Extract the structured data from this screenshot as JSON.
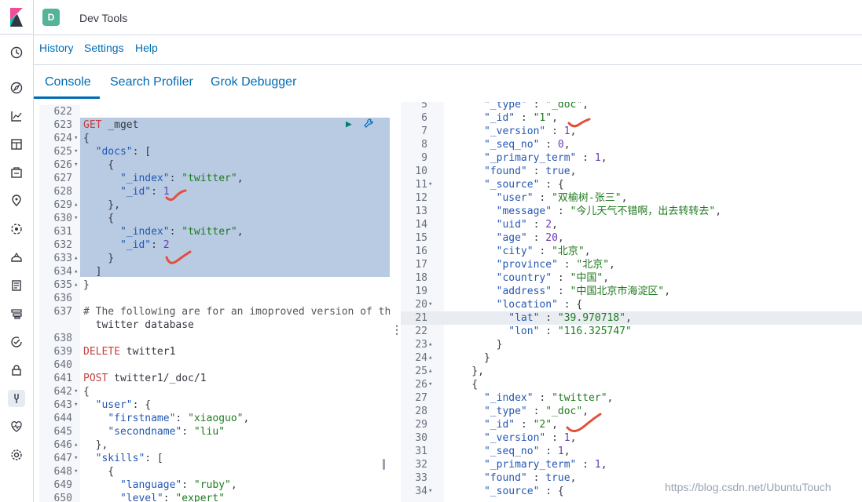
{
  "header": {
    "avatar_letter": "D",
    "title": "Dev Tools"
  },
  "top_menu": {
    "history": "History",
    "settings": "Settings",
    "help": "Help"
  },
  "tabs": {
    "console": "Console",
    "search_profiler": "Search Profiler",
    "grok_debugger": "Grok Debugger"
  },
  "editor": {
    "lines": [
      {
        "n": "622",
        "f": "",
        "t": ""
      },
      {
        "n": "623",
        "f": "",
        "t": "GET _mget"
      },
      {
        "n": "624",
        "f": "▾",
        "t": "{"
      },
      {
        "n": "625",
        "f": "▾",
        "t": "  \"docs\": ["
      },
      {
        "n": "626",
        "f": "▾",
        "t": "    {"
      },
      {
        "n": "627",
        "f": "",
        "t": "      \"_index\": \"twitter\","
      },
      {
        "n": "628",
        "f": "",
        "t": "      \"_id\": 1"
      },
      {
        "n": "629",
        "f": "▴",
        "t": "    },"
      },
      {
        "n": "630",
        "f": "▾",
        "t": "    {"
      },
      {
        "n": "631",
        "f": "",
        "t": "      \"_index\": \"twitter\","
      },
      {
        "n": "632",
        "f": "",
        "t": "      \"_id\": 2"
      },
      {
        "n": "633",
        "f": "▴",
        "t": "    }"
      },
      {
        "n": "634",
        "f": "▴",
        "t": "  ]"
      },
      {
        "n": "635",
        "f": "▴",
        "t": "}"
      },
      {
        "n": "636",
        "f": "",
        "t": ""
      },
      {
        "n": "637",
        "f": "",
        "t": "# The following are for an imoproved version of the"
      },
      {
        "n": "",
        "f": "",
        "t": "  twitter database"
      },
      {
        "n": "638",
        "f": "",
        "t": ""
      },
      {
        "n": "639",
        "f": "",
        "t": "DELETE twitter1"
      },
      {
        "n": "640",
        "f": "",
        "t": ""
      },
      {
        "n": "641",
        "f": "",
        "t": "POST twitter1/_doc/1"
      },
      {
        "n": "642",
        "f": "▾",
        "t": "{"
      },
      {
        "n": "643",
        "f": "▾",
        "t": "  \"user\": {"
      },
      {
        "n": "644",
        "f": "",
        "t": "    \"firstname\": \"xiaoguo\","
      },
      {
        "n": "645",
        "f": "",
        "t": "    \"secondname\": \"liu\""
      },
      {
        "n": "646",
        "f": "▴",
        "t": "  },"
      },
      {
        "n": "647",
        "f": "▾",
        "t": "  \"skills\": ["
      },
      {
        "n": "648",
        "f": "▾",
        "t": "    {"
      },
      {
        "n": "649",
        "f": "",
        "t": "      \"language\": \"ruby\","
      },
      {
        "n": "650",
        "f": "",
        "t": "      \"level\": \"expert\""
      }
    ]
  },
  "output": {
    "lines": [
      {
        "n": "5",
        "f": "",
        "t": "      \"_type\" : \"_doc\","
      },
      {
        "n": "6",
        "f": "",
        "t": "      \"_id\" : \"1\","
      },
      {
        "n": "7",
        "f": "",
        "t": "      \"_version\" : 1,"
      },
      {
        "n": "8",
        "f": "",
        "t": "      \"_seq_no\" : 0,"
      },
      {
        "n": "9",
        "f": "",
        "t": "      \"_primary_term\" : 1,"
      },
      {
        "n": "10",
        "f": "",
        "t": "      \"found\" : true,"
      },
      {
        "n": "11",
        "f": "▾",
        "t": "      \"_source\" : {"
      },
      {
        "n": "12",
        "f": "",
        "t": "        \"user\" : \"双榆树-张三\","
      },
      {
        "n": "13",
        "f": "",
        "t": "        \"message\" : \"今儿天气不错啊，出去转转去\","
      },
      {
        "n": "14",
        "f": "",
        "t": "        \"uid\" : 2,"
      },
      {
        "n": "15",
        "f": "",
        "t": "        \"age\" : 20,"
      },
      {
        "n": "16",
        "f": "",
        "t": "        \"city\" : \"北京\","
      },
      {
        "n": "17",
        "f": "",
        "t": "        \"province\" : \"北京\","
      },
      {
        "n": "18",
        "f": "",
        "t": "        \"country\" : \"中国\","
      },
      {
        "n": "19",
        "f": "",
        "t": "        \"address\" : \"中国北京市海淀区\","
      },
      {
        "n": "20",
        "f": "▾",
        "t": "        \"location\" : {"
      },
      {
        "n": "21",
        "f": "",
        "t": "          \"lat\" : \"39.970718\","
      },
      {
        "n": "22",
        "f": "",
        "t": "          \"lon\" : \"116.325747\""
      },
      {
        "n": "23",
        "f": "▴",
        "t": "        }"
      },
      {
        "n": "24",
        "f": "▴",
        "t": "      }"
      },
      {
        "n": "25",
        "f": "▴",
        "t": "    },"
      },
      {
        "n": "26",
        "f": "▾",
        "t": "    {"
      },
      {
        "n": "27",
        "f": "",
        "t": "      \"_index\" : \"twitter\","
      },
      {
        "n": "28",
        "f": "",
        "t": "      \"_type\" : \"_doc\","
      },
      {
        "n": "29",
        "f": "",
        "t": "      \"_id\" : \"2\","
      },
      {
        "n": "30",
        "f": "",
        "t": "      \"_version\" : 1,"
      },
      {
        "n": "31",
        "f": "",
        "t": "      \"_seq_no\" : 1,"
      },
      {
        "n": "32",
        "f": "",
        "t": "      \"_primary_term\" : 1,"
      },
      {
        "n": "33",
        "f": "",
        "t": "      \"found\" : true,"
      },
      {
        "n": "34",
        "f": "▾",
        "t": "      \"_source\" : {"
      }
    ]
  },
  "watermark": "https://blog.csdn.net/UbuntuTouch",
  "colors": {
    "accent": "#006bb4",
    "selection": "#b8cbe3",
    "annotation": "#e0503a"
  },
  "icons": [
    "kibana-logo-icon",
    "clock-icon",
    "discover-icon",
    "visualize-icon",
    "dashboard-icon",
    "canvas-icon",
    "maps-icon",
    "ml-icon",
    "infrastructure-icon",
    "logs-icon",
    "apm-icon",
    "uptime-icon",
    "security-icon",
    "devtools-icon",
    "monitoring-icon",
    "management-icon",
    "play-icon",
    "wrench-icon"
  ]
}
